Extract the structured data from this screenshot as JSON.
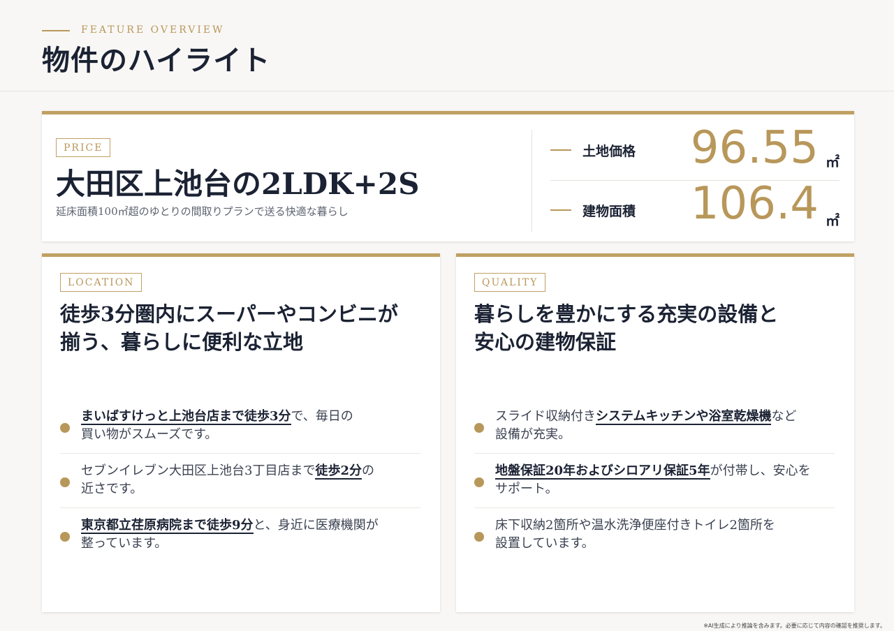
{
  "header": {
    "eyebrow": "FEATURE OVERVIEW",
    "title": "物件のハイライト"
  },
  "price_card": {
    "tag": "PRICE",
    "title": "大田区上池台の2LDK+2S",
    "subtitle": "延床面積100㎡超のゆとりの間取りプランで送る快適な暮らし",
    "stats": [
      {
        "label": "土地価格",
        "value": "96.55",
        "unit": "㎡"
      },
      {
        "label": "建物面積",
        "value": "106.4",
        "unit": "㎡"
      }
    ]
  },
  "location": {
    "tag": "LOCATION",
    "title_line1": "徒歩3分圏内にスーパーやコンビニが",
    "title_line2": "揃う、暮らしに便利な立地",
    "items": [
      {
        "pre": "",
        "em": "まいばすけっと上池台店まで徒歩3分",
        "post": "で、毎日の",
        "line2": "買い物がスムーズです。"
      },
      {
        "pre": "セブンイレブン大田区上池台3丁目店まで",
        "em": "徒歩2分",
        "post": "の",
        "line2": "近さです。"
      },
      {
        "pre": "",
        "em": "東京都立荏原病院まで徒歩9分",
        "post": "と、身近に医療機関が",
        "line2": "整っています。"
      }
    ]
  },
  "quality": {
    "tag": "QUALITY",
    "title_line1": "暮らしを豊かにする充実の設備と",
    "title_line2": "安心の建物保証",
    "items": [
      {
        "pre": "スライド収納付き",
        "em": "システムキッチンや浴室乾燥機",
        "post": "など",
        "line2": "設備が充実。"
      },
      {
        "pre": "",
        "em": "地盤保証20年およびシロアリ保証5年",
        "post": "が付帯し、安心を",
        "line2": "サポート。"
      },
      {
        "pre": "床下収納2箇所や温水洗浄便座付きトイレ2箇所を",
        "em": "",
        "post": "",
        "line2": "設置しています。"
      }
    ]
  },
  "footnote": "※AI生成により推論を含みます。必要に応じて内容の確認を推奨します。",
  "colors": {
    "accent": "#b8975a",
    "text": "#1b2233",
    "background": "#f8f7f5"
  }
}
